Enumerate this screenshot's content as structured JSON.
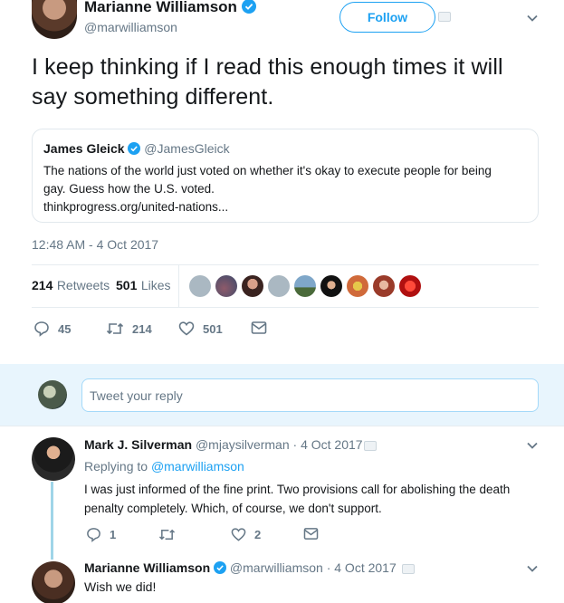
{
  "main_tweet": {
    "author_name": "Marianne Williamson",
    "handle": "@marwilliamson",
    "follow_label": "Follow",
    "text": "I keep thinking if I read this enough times it will say something different.",
    "timestamp": "12:48 AM - 4 Oct 2017"
  },
  "quoted_tweet": {
    "author_name": "James Gleick",
    "handle": "@JamesGleick",
    "text_line1": "The nations of the world just voted on whether it's okay to execute people for being",
    "text_line2": "gay. Guess how the U.S. voted.",
    "link": "thinkprogress.org/united-nations..."
  },
  "stats": {
    "retweets_count": "214",
    "retweets_label": "Retweets",
    "likes_count": "501",
    "likes_label": "Likes"
  },
  "actions": {
    "replies": "45",
    "retweets": "214",
    "likes": "501"
  },
  "reply_box": {
    "placeholder": "Tweet your reply"
  },
  "reply1": {
    "author_name": "Mark J. Silverman",
    "handle": "@mjaysilverman",
    "date": "· 4 Oct 2017",
    "replying_prefix": "Replying to",
    "replying_handle": "@marwilliamson",
    "text_line1": "I was just informed of the fine print. Two provisions call for abolishing the death",
    "text_line2": "penalty completely. Which, of course, we don't support.",
    "replies": "1",
    "retweets": "",
    "likes": "2"
  },
  "reply2": {
    "author_name": "Marianne Williamson",
    "handle": "@marwilliamson",
    "date": "· 4 Oct 2017",
    "text": "Wish we did!"
  },
  "colors": {
    "accent": "#1da1f2",
    "muted": "#657786",
    "reply_bg": "#e8f5fd",
    "thread_line": "#9fd5e8"
  }
}
